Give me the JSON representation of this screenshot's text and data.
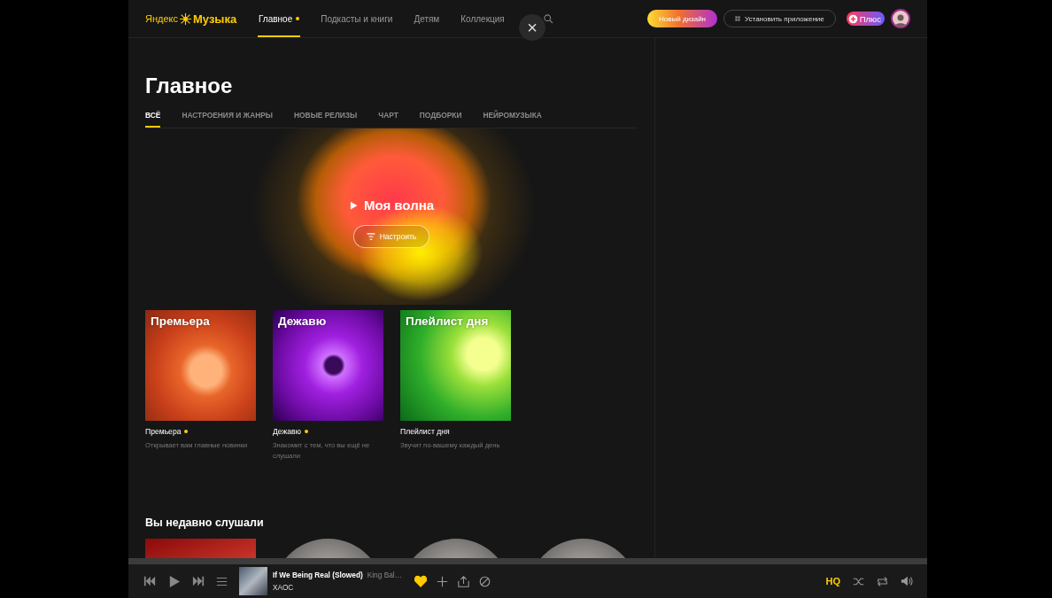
{
  "header": {
    "logo": {
      "brand": "Яндекс",
      "product": "Музыка"
    },
    "nav": [
      {
        "label": "Главное",
        "selected": true,
        "dot": true
      },
      {
        "label": "Подкасты и книги",
        "selected": false,
        "dot": false
      },
      {
        "label": "Детям",
        "selected": false,
        "dot": false
      },
      {
        "label": "Коллекция",
        "selected": false,
        "dot": false
      }
    ],
    "close": "×",
    "new_design": "Новый дизайн",
    "install": "Установить приложение",
    "plus": "Плюс"
  },
  "page": {
    "title": "Главное",
    "tabs": [
      {
        "label": "ВСЁ",
        "selected": true
      },
      {
        "label": "НАСТРОЕНИЯ И ЖАНРЫ",
        "selected": false
      },
      {
        "label": "НОВЫЕ РЕЛИЗЫ",
        "selected": false
      },
      {
        "label": "ЧАРТ",
        "selected": false
      },
      {
        "label": "ПОДБОРКИ",
        "selected": false
      },
      {
        "label": "НЕЙРОМУЗЫКА",
        "selected": false
      }
    ]
  },
  "wave": {
    "title": "Моя волна",
    "tune": "Настроить"
  },
  "playlists": [
    {
      "kind": "premiere",
      "cover_title": "Премьера",
      "name": "Премьера",
      "dot": true,
      "description": "Открывает вам главные новинки"
    },
    {
      "kind": "dejavu",
      "cover_title": "Дежавю",
      "name": "Дежавю",
      "dot": true,
      "description": "Знакомит с тем, что вы ещё не слушали"
    },
    {
      "kind": "daily",
      "cover_title": "Плейлист дня",
      "name": "Плейлист дня",
      "dot": false,
      "description": "Звучит по-вашему каждый день"
    }
  ],
  "recent": {
    "title": "Вы недавно слушали",
    "items": [
      {
        "kind": "square"
      },
      {
        "kind": "round"
      },
      {
        "kind": "round"
      },
      {
        "kind": "round"
      }
    ]
  },
  "player": {
    "track": "If We Being Real (Slowed)",
    "artist": "King Bal…",
    "album": "ХАОС",
    "liked": true,
    "quality": "HQ"
  }
}
